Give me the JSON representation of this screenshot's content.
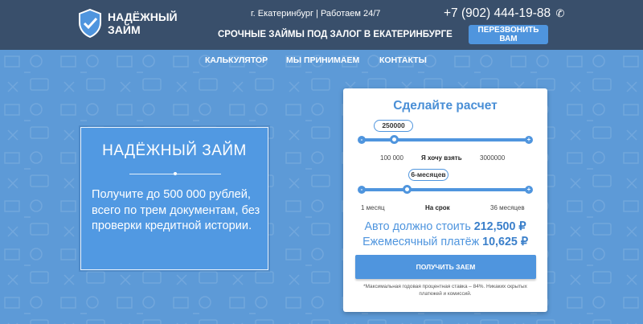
{
  "header": {
    "logo_line1": "НАДЁЖНЫЙ",
    "logo_line2": "ЗАЙМ",
    "city_hours": "г. Екатеринбург  | Работаем 24/7",
    "tagline": "СРОЧНЫЕ ЗАЙМЫ ПОД ЗАЛОГ В ЕКАТЕРИНБУРГЕ",
    "phone": "+7 (902) 444-19-88",
    "callback_label": "ПЕРЕЗВОНИТЬ ВАМ"
  },
  "nav": {
    "items": [
      "КАЛЬКУЛЯТОР",
      "МЫ ПРИНИМАЕМ",
      "КОНТАКТЫ"
    ]
  },
  "hero": {
    "title": "НАДЁЖНЫЙ ЗАЙМ",
    "text": "Получите до 500 000 рублей, всего по трем документам, без проверки кредитной истории."
  },
  "calculator": {
    "title": "Сделайте расчет",
    "amount": {
      "value": "250000",
      "min_label": "100 000",
      "center_label": "Я хочу взять",
      "max_label": "3000000",
      "minus": "-",
      "plus": "+"
    },
    "term": {
      "value": "6-месяцев",
      "min_label": "1 месяц",
      "center_label": "На срок",
      "max_label": "36 месяцев",
      "minus": "-",
      "plus": "+"
    },
    "car_cost_label": "Авто должно стоить",
    "car_cost_value": "212,500 ₽",
    "monthly_label": "Ежемесячный платёж",
    "monthly_value": "10,625 ₽",
    "submit_label": "ПОЛУЧИТЬ ЗАЕМ",
    "note": "*Максимальная годовая процентная ставка – 84%. Никаких скрытых платежей и комиссий."
  },
  "colors": {
    "header_bg": "#394f6b",
    "page_bg": "#5d9ad7",
    "accent": "#4f95de"
  }
}
